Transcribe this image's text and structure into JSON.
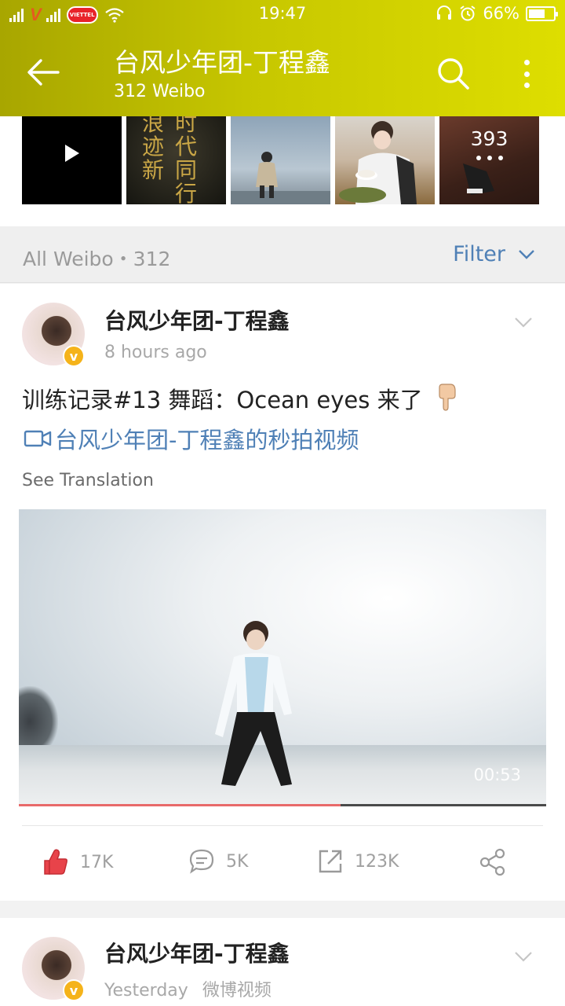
{
  "status_bar": {
    "carrier_1": "V",
    "carrier_2": "VIETTEL",
    "time": "19:47",
    "battery": "66%",
    "battery_level": 0.66,
    "icons": [
      "signal-icon",
      "wifi-icon",
      "headset-icon",
      "alarm-icon",
      "battery-icon"
    ]
  },
  "header": {
    "title": "台风少年团-丁程鑫",
    "subtitle": "312 Weibo",
    "icons": [
      "back-arrow-icon",
      "search-icon",
      "more-vertical-icon"
    ],
    "colors": {
      "start": "#a8a600",
      "end": "#dede00"
    }
  },
  "media_strip": {
    "poster_text_1": "浪迹新",
    "poster_text_2": "时代同行",
    "more_count": "393"
  },
  "filter_bar": {
    "label": "All Weibo・312",
    "filter_label": "Filter"
  },
  "posts": [
    {
      "author": "台风少年团-丁程鑫",
      "time": "8 hours ago",
      "source": "",
      "text": "训练记录#13 舞蹈：Ocean eyes 来了",
      "video_link": "台风少年团-丁程鑫的秒拍视频",
      "see_translation": "See Translation",
      "video": {
        "duration": "00:53",
        "progress": 0.61
      },
      "actions": {
        "likes": "17K",
        "comments": "5K",
        "reposts": "123K"
      }
    },
    {
      "author": "台风少年团-丁程鑫",
      "time": "Yesterday",
      "source": "微博视频"
    }
  ],
  "colors": {
    "link": "#4f80b6",
    "like_red": "#e8434a"
  }
}
